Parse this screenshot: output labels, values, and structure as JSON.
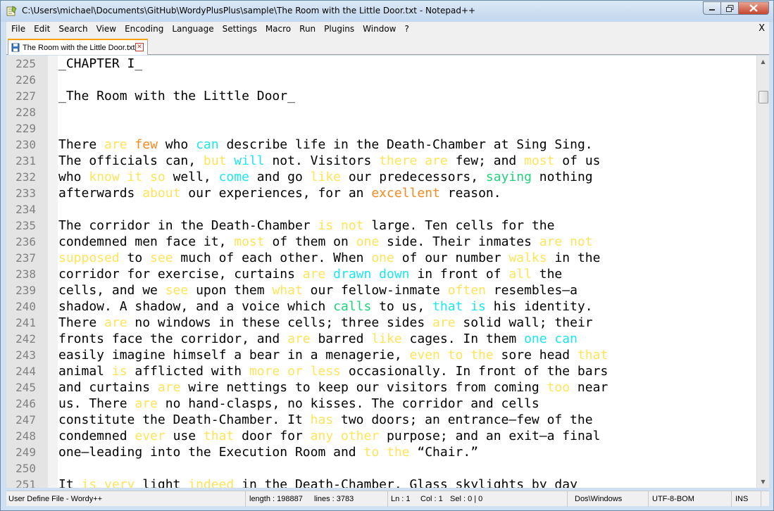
{
  "window": {
    "title": "C:\\Users\\michael\\Documents\\GitHub\\WordyPlusPlus\\sample\\The Room with the Little Door.txt - Notepad++"
  },
  "menu": {
    "items": [
      "File",
      "Edit",
      "Search",
      "View",
      "Encoding",
      "Language",
      "Settings",
      "Macro",
      "Run",
      "Plugins",
      "Window",
      "?"
    ],
    "close_label": "X"
  },
  "tabs": [
    {
      "label": "The Room with the Little Door.txt"
    }
  ],
  "colors": {
    "yellow_word": "#ffe45a",
    "cyan_word": "#1ce6f0",
    "green_word": "#22d27a",
    "orange_word": "#f7891e",
    "tab_accent": "#f9a000"
  },
  "editor": {
    "lines": [
      {
        "num": "225",
        "segments": [
          {
            "t": "_CHAPTER I_"
          }
        ]
      },
      {
        "num": "226",
        "segments": []
      },
      {
        "num": "227",
        "segments": [
          {
            "t": "_The Room with the Little Door_"
          }
        ]
      },
      {
        "num": "228",
        "segments": []
      },
      {
        "num": "229",
        "segments": []
      },
      {
        "num": "230",
        "segments": [
          {
            "t": "There "
          },
          {
            "t": "are",
            "c": "y"
          },
          {
            "t": " "
          },
          {
            "t": "few",
            "c": "o"
          },
          {
            "t": " who "
          },
          {
            "t": "can",
            "c": "c"
          },
          {
            "t": " describe life in the Death-Chamber at Sing Sing."
          }
        ]
      },
      {
        "num": "231",
        "segments": [
          {
            "t": "The officials can, "
          },
          {
            "t": "but",
            "c": "y"
          },
          {
            "t": " "
          },
          {
            "t": "will",
            "c": "c"
          },
          {
            "t": " not. Visitors "
          },
          {
            "t": "there are",
            "c": "y"
          },
          {
            "t": " few; and "
          },
          {
            "t": "most",
            "c": "y"
          },
          {
            "t": " of us"
          }
        ]
      },
      {
        "num": "232",
        "segments": [
          {
            "t": "who "
          },
          {
            "t": "know it so",
            "c": "y"
          },
          {
            "t": " well, "
          },
          {
            "t": "come",
            "c": "c"
          },
          {
            "t": " and go "
          },
          {
            "t": "like",
            "c": "y"
          },
          {
            "t": " our predecessors, "
          },
          {
            "t": "saying",
            "c": "g"
          },
          {
            "t": " nothing"
          }
        ]
      },
      {
        "num": "233",
        "segments": [
          {
            "t": "afterwards "
          },
          {
            "t": "about",
            "c": "y"
          },
          {
            "t": " our experiences, for an "
          },
          {
            "t": "excellent",
            "c": "o"
          },
          {
            "t": " reason."
          }
        ]
      },
      {
        "num": "234",
        "segments": []
      },
      {
        "num": "235",
        "segments": [
          {
            "t": "The corridor in the Death-Chamber "
          },
          {
            "t": "is not",
            "c": "y"
          },
          {
            "t": " large. Ten cells for the"
          }
        ]
      },
      {
        "num": "236",
        "segments": [
          {
            "t": "condemned men face it, "
          },
          {
            "t": "most",
            "c": "y"
          },
          {
            "t": " of them on "
          },
          {
            "t": "one",
            "c": "y"
          },
          {
            "t": " side. Their inmates "
          },
          {
            "t": "are not",
            "c": "y"
          }
        ]
      },
      {
        "num": "237",
        "segments": [
          {
            "t": "supposed",
            "c": "y"
          },
          {
            "t": " to "
          },
          {
            "t": "see",
            "c": "y"
          },
          {
            "t": " much of each other. When "
          },
          {
            "t": "one",
            "c": "y"
          },
          {
            "t": " of our number "
          },
          {
            "t": "walks",
            "c": "y"
          },
          {
            "t": " in the"
          }
        ]
      },
      {
        "num": "238",
        "segments": [
          {
            "t": "corridor for exercise, curtains "
          },
          {
            "t": "are",
            "c": "y"
          },
          {
            "t": " "
          },
          {
            "t": "drawn down",
            "c": "c"
          },
          {
            "t": " in front of "
          },
          {
            "t": "all",
            "c": "y"
          },
          {
            "t": " the"
          }
        ]
      },
      {
        "num": "239",
        "segments": [
          {
            "t": "cells, and we "
          },
          {
            "t": "see",
            "c": "y"
          },
          {
            "t": " upon them "
          },
          {
            "t": "what",
            "c": "y"
          },
          {
            "t": " our fellow-inmate "
          },
          {
            "t": "often",
            "c": "y"
          },
          {
            "t": " resembles—a"
          }
        ]
      },
      {
        "num": "240",
        "segments": [
          {
            "t": "shadow. A shadow, and a voice which "
          },
          {
            "t": "calls",
            "c": "g"
          },
          {
            "t": " to us, "
          },
          {
            "t": "that is",
            "c": "c"
          },
          {
            "t": " his identity."
          }
        ]
      },
      {
        "num": "241",
        "segments": [
          {
            "t": "There "
          },
          {
            "t": "are",
            "c": "y"
          },
          {
            "t": " no windows in these cells; three sides "
          },
          {
            "t": "are",
            "c": "y"
          },
          {
            "t": " solid wall; their"
          }
        ]
      },
      {
        "num": "242",
        "segments": [
          {
            "t": "fronts face the corridor, and "
          },
          {
            "t": "are",
            "c": "y"
          },
          {
            "t": " barred "
          },
          {
            "t": "like",
            "c": "y"
          },
          {
            "t": " cages. In them "
          },
          {
            "t": "one can",
            "c": "c"
          }
        ]
      },
      {
        "num": "243",
        "segments": [
          {
            "t": "easily imagine himself a bear in a menagerie, "
          },
          {
            "t": "even to the",
            "c": "y"
          },
          {
            "t": " sore head "
          },
          {
            "t": "that",
            "c": "y"
          }
        ]
      },
      {
        "num": "244",
        "segments": [
          {
            "t": "animal "
          },
          {
            "t": "is",
            "c": "y"
          },
          {
            "t": " afflicted with "
          },
          {
            "t": "more or less",
            "c": "y"
          },
          {
            "t": " occasionally. In front of the bars"
          }
        ]
      },
      {
        "num": "245",
        "segments": [
          {
            "t": "and curtains "
          },
          {
            "t": "are",
            "c": "y"
          },
          {
            "t": " wire nettings to keep our visitors from coming "
          },
          {
            "t": "too",
            "c": "y"
          },
          {
            "t": " near"
          }
        ]
      },
      {
        "num": "246",
        "segments": [
          {
            "t": "us. There "
          },
          {
            "t": "are",
            "c": "y"
          },
          {
            "t": " no hand-clasps, no kisses. The corridor and cells"
          }
        ]
      },
      {
        "num": "247",
        "segments": [
          {
            "t": "constitute the Death-Chamber. It "
          },
          {
            "t": "has",
            "c": "y"
          },
          {
            "t": " two doors; an entrance—few of the"
          }
        ]
      },
      {
        "num": "248",
        "segments": [
          {
            "t": "condemned "
          },
          {
            "t": "ever",
            "c": "y"
          },
          {
            "t": " use "
          },
          {
            "t": "that",
            "c": "y"
          },
          {
            "t": " door for "
          },
          {
            "t": "any other",
            "c": "y"
          },
          {
            "t": " purpose; and an exit—a final"
          }
        ]
      },
      {
        "num": "249",
        "segments": [
          {
            "t": "one—leading into the Execution Room and "
          },
          {
            "t": "to the",
            "c": "y"
          },
          {
            "t": " “Chair.”"
          }
        ]
      },
      {
        "num": "250",
        "segments": []
      },
      {
        "num": "251",
        "segments": [
          {
            "t": "It "
          },
          {
            "t": "is very",
            "c": "y"
          },
          {
            "t": " light "
          },
          {
            "t": "indeed",
            "c": "y"
          },
          {
            "t": " in the Death-Chamber. Glass skylights by day"
          }
        ]
      }
    ]
  },
  "status": {
    "lang": "User Define File - Wordy++",
    "length": "length : 198887",
    "lines": "lines : 3783",
    "ln": "Ln : 1",
    "col": "Col : 1",
    "sel": "Sel : 0 | 0",
    "eol": "Dos\\Windows",
    "encoding": "UTF-8-BOM",
    "mode": "INS"
  }
}
